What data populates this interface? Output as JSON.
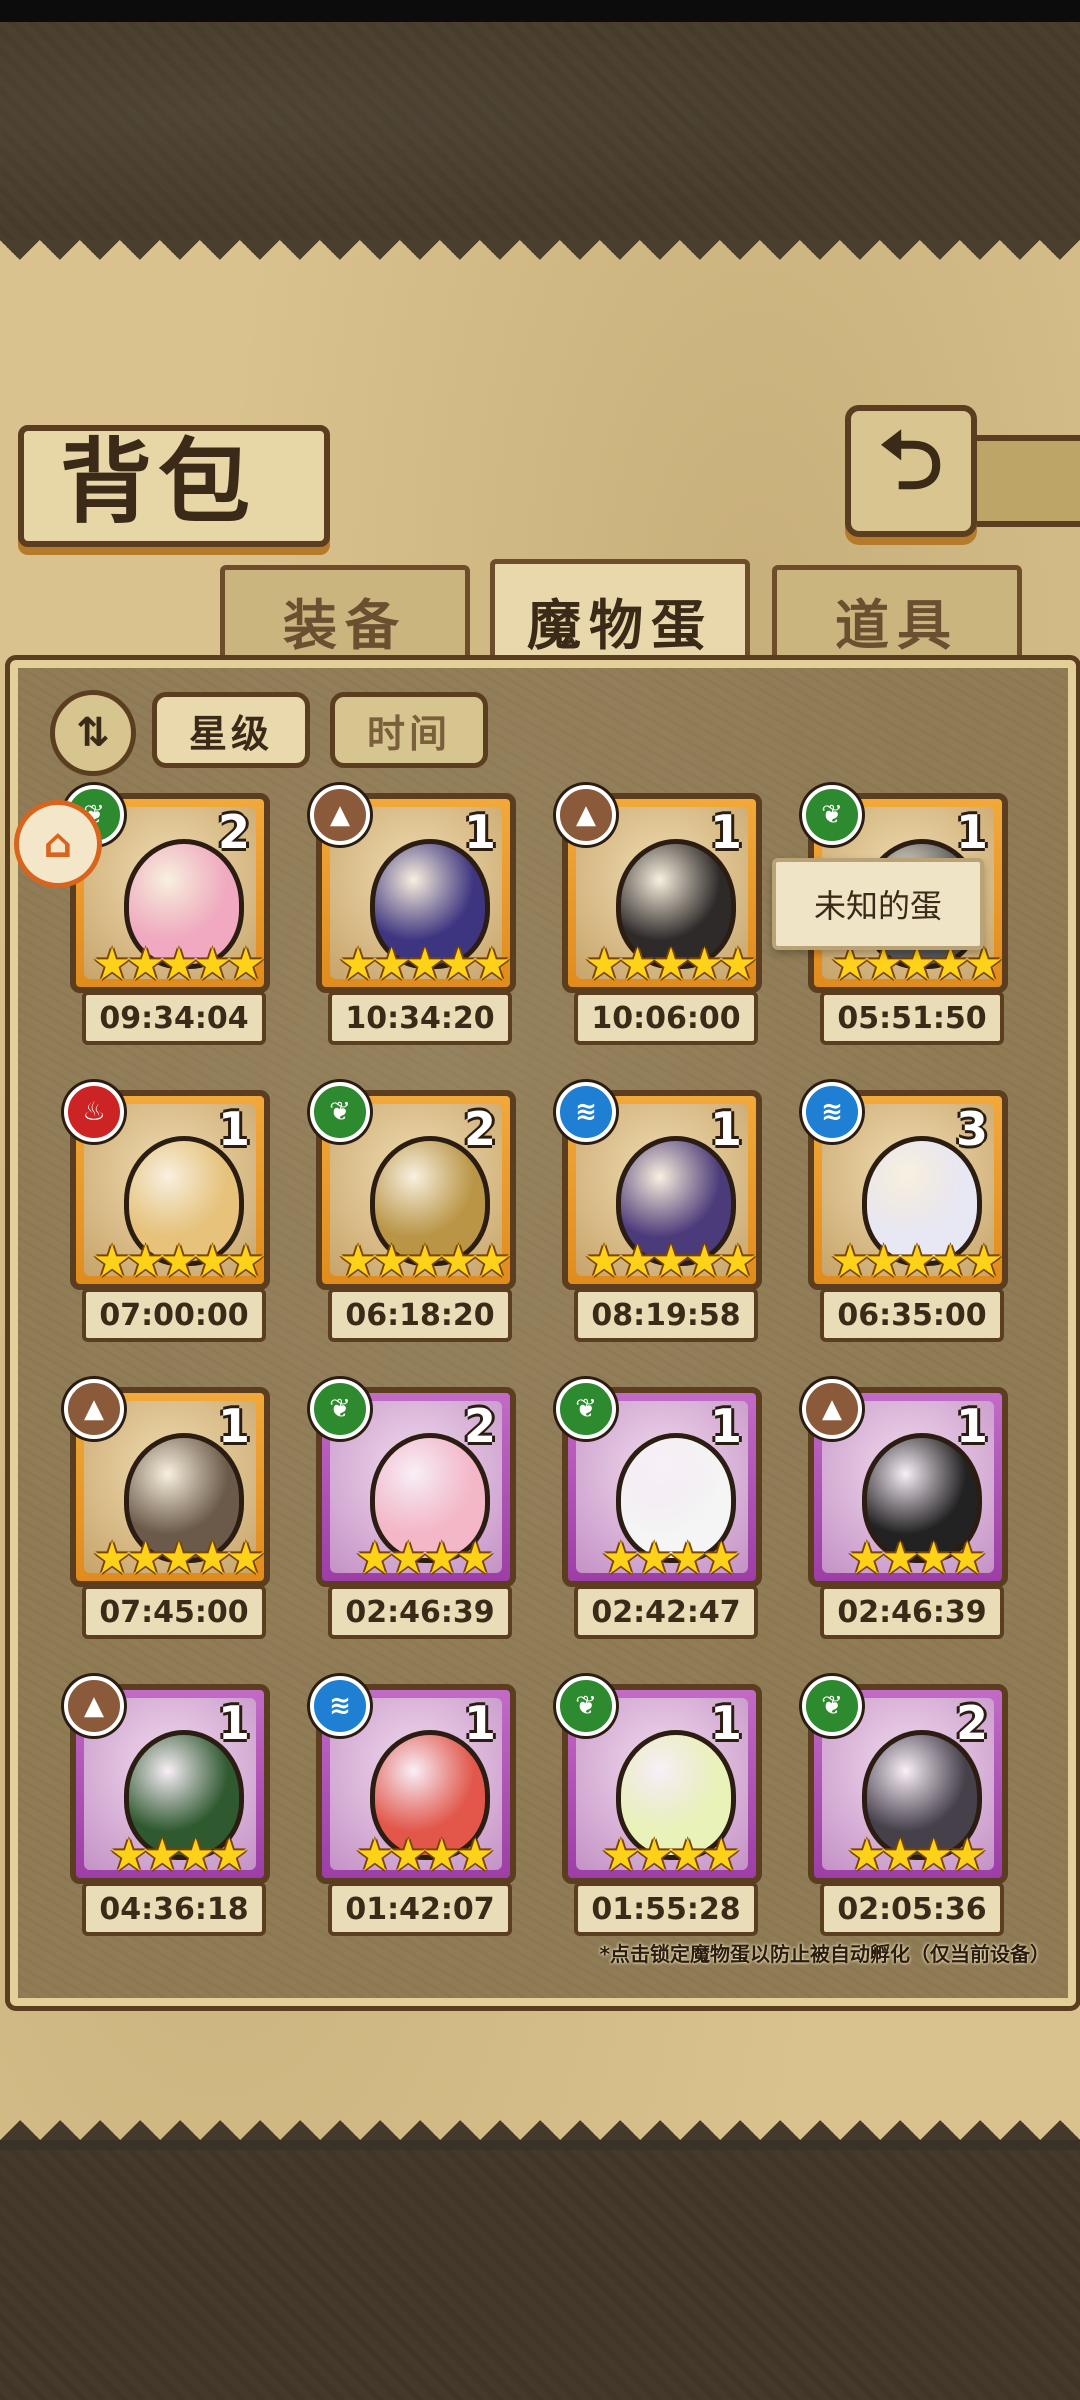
{
  "header": {
    "title": "背包"
  },
  "tabs": [
    {
      "label": "装备"
    },
    {
      "label": "魔物蛋"
    },
    {
      "label": "道具"
    }
  ],
  "sort": {
    "toggle_icon": "sort-toggle-icon",
    "star_label": "星级",
    "time_label": "时间"
  },
  "tooltip": "未知的蛋",
  "footnote": "*点击锁定魔物蛋以防止被自动孵化（仅当前设备）",
  "cards": [
    {
      "element": "wood",
      "count": "2",
      "time": "09:34:04",
      "stars": "★★★★★",
      "rarity": "gold",
      "color": "#f0a9c0"
    },
    {
      "element": "earth",
      "count": "1",
      "time": "10:34:20",
      "stars": "★★★★★",
      "rarity": "gold",
      "color": "#3d3580"
    },
    {
      "element": "earth",
      "count": "1",
      "time": "10:06:00",
      "stars": "★★★★★",
      "rarity": "gold",
      "color": "#2e2a2a"
    },
    {
      "element": "wood",
      "count": "1",
      "time": "05:51:50",
      "stars": "★★★★★",
      "rarity": "gold",
      "color": "#555555"
    },
    {
      "element": "fire",
      "count": "1",
      "time": "07:00:00",
      "stars": "★★★★★",
      "rarity": "gold",
      "color": "#e6c27a"
    },
    {
      "element": "wood",
      "count": "2",
      "time": "06:18:20",
      "stars": "★★★★★",
      "rarity": "gold",
      "color": "#b99545"
    },
    {
      "element": "water",
      "count": "1",
      "time": "08:19:58",
      "stars": "★★★★★",
      "rarity": "gold",
      "color": "#4c3b7a"
    },
    {
      "element": "water",
      "count": "3",
      "time": "06:35:00",
      "stars": "★★★★★",
      "rarity": "gold",
      "color": "#e8e8f5"
    },
    {
      "element": "earth",
      "count": "1",
      "time": "07:45:00",
      "stars": "★★★★★",
      "rarity": "gold",
      "color": "#6b5a4a"
    },
    {
      "element": "wood",
      "count": "2",
      "time": "02:46:39",
      "stars": "★★★★",
      "rarity": "purple",
      "color": "#f4b7c7"
    },
    {
      "element": "wood",
      "count": "1",
      "time": "02:42:47",
      "stars": "★★★★",
      "rarity": "purple",
      "color": "#f5f5f5"
    },
    {
      "element": "earth",
      "count": "1",
      "time": "02:46:39",
      "stars": "★★★★",
      "rarity": "purple",
      "color": "#222222"
    },
    {
      "element": "earth",
      "count": "1",
      "time": "04:36:18",
      "stars": "★★★★",
      "rarity": "purple",
      "color": "#2f5a30"
    },
    {
      "element": "water",
      "count": "1",
      "time": "01:42:07",
      "stars": "★★★★",
      "rarity": "purple",
      "color": "#e2574a"
    },
    {
      "element": "wood",
      "count": "1",
      "time": "01:55:28",
      "stars": "★★★★",
      "rarity": "purple",
      "color": "#e9f2b8"
    },
    {
      "element": "wood",
      "count": "2",
      "time": "02:05:36",
      "stars": "★★★★",
      "rarity": "purple",
      "color": "#45404a"
    }
  ]
}
